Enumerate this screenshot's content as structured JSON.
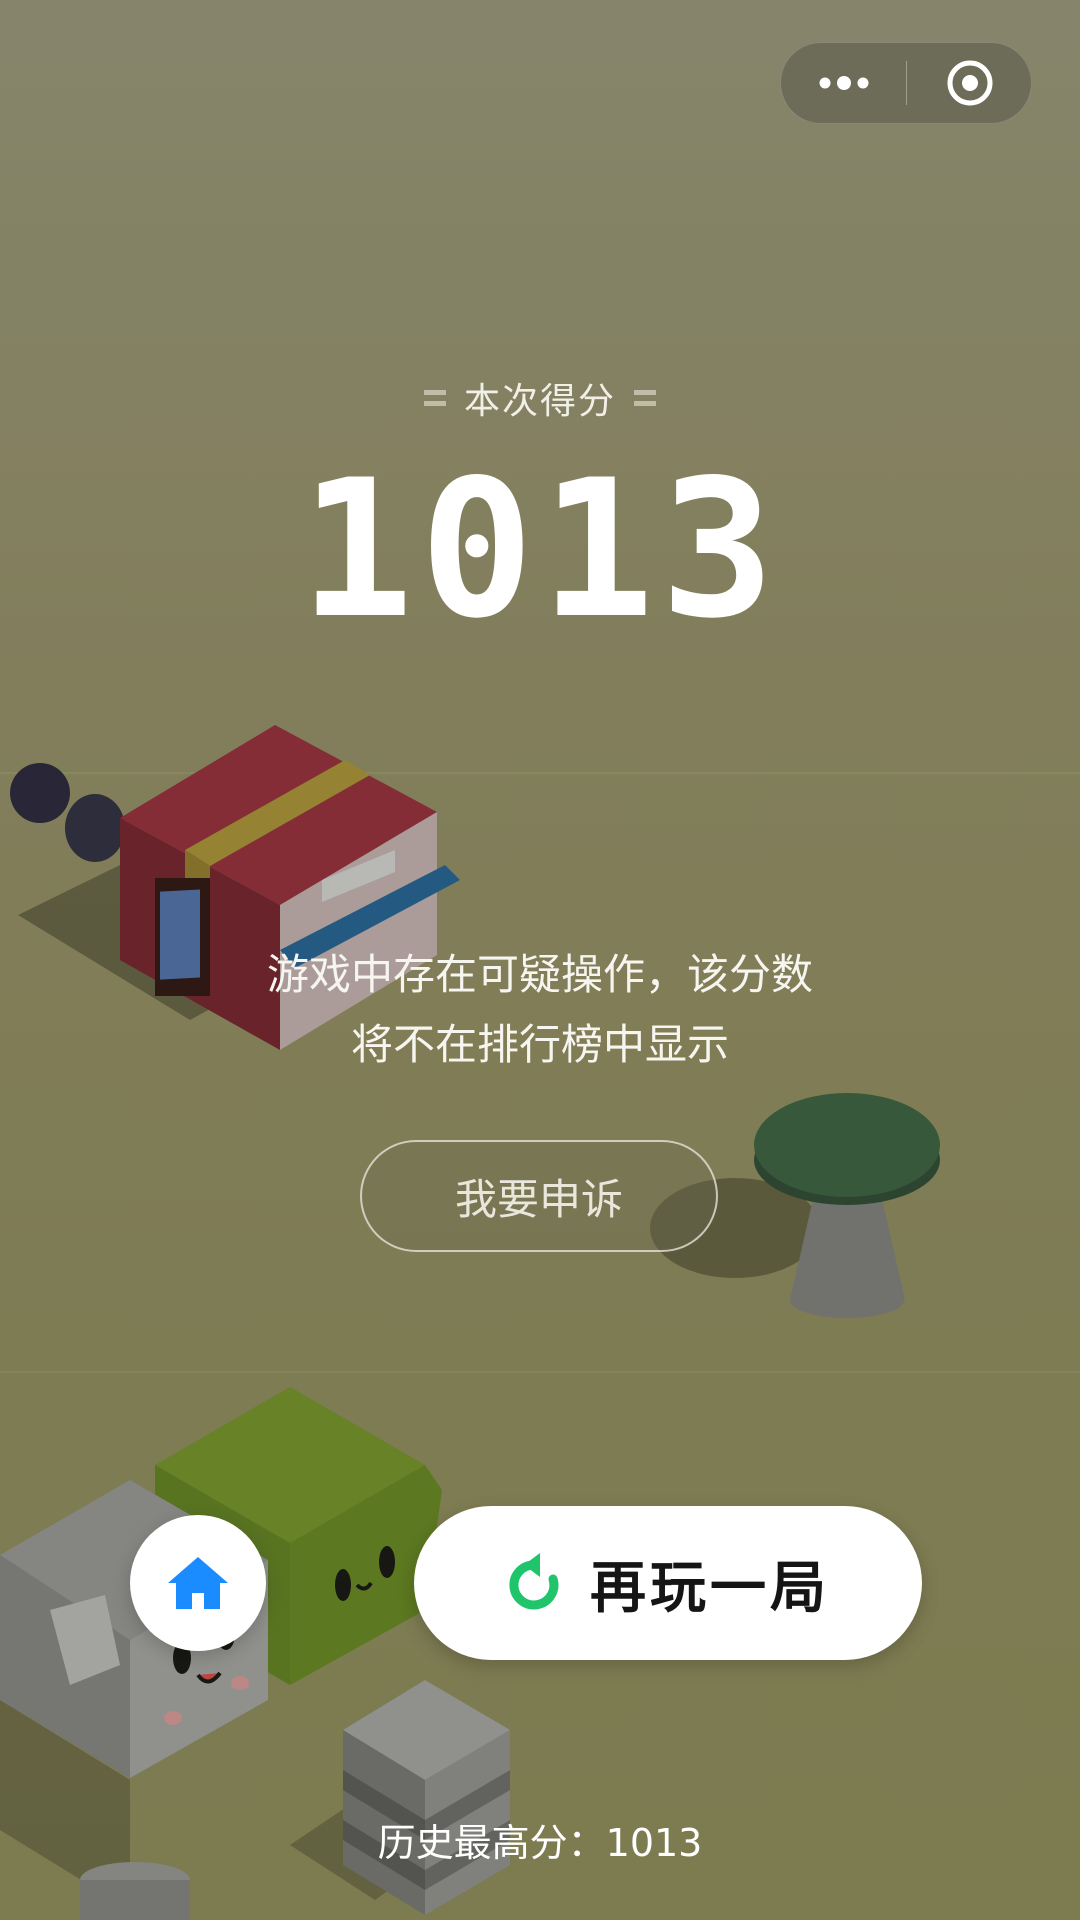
{
  "capsule": {
    "more_icon": "more-dots-icon",
    "close_icon": "target-close-icon"
  },
  "score": {
    "label": "本次得分",
    "value": "1013"
  },
  "warning": {
    "line1": "游戏中存在可疑操作，该分数",
    "line2": "将不在排行榜中显示"
  },
  "appeal_button": {
    "label": "我要申诉"
  },
  "home_button": {
    "icon": "home-icon",
    "color": "#1a8cff"
  },
  "replay_button": {
    "label": "再玩一局",
    "icon": "replay-icon",
    "icon_color": "#1fc46b"
  },
  "best_score": {
    "text": "历史最高分：1013"
  }
}
